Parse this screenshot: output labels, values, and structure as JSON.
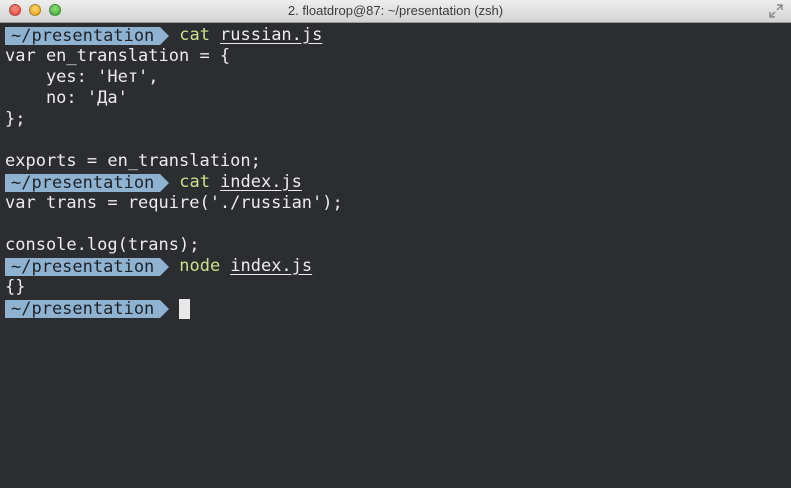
{
  "window": {
    "title": "2. floatdrop@87: ~/presentation (zsh)"
  },
  "colors": {
    "background": "#2b2d31",
    "prompt": "#8fb2d0",
    "command": "#cde08a",
    "text": "#ececec"
  },
  "prompt_text": "~/presentation",
  "blocks": [
    {
      "command": "cat",
      "argument": "russian.js",
      "output": [
        "var en_translation = {",
        "    yes: 'Нет',",
        "    no: 'Да'",
        "};",
        "",
        "exports = en_translation;"
      ]
    },
    {
      "command": "cat",
      "argument": "index.js",
      "output": [
        "var trans = require('./russian');",
        "",
        "console.log(trans);"
      ]
    },
    {
      "command": "node",
      "argument": "index.js",
      "output": [
        "{}"
      ]
    }
  ]
}
